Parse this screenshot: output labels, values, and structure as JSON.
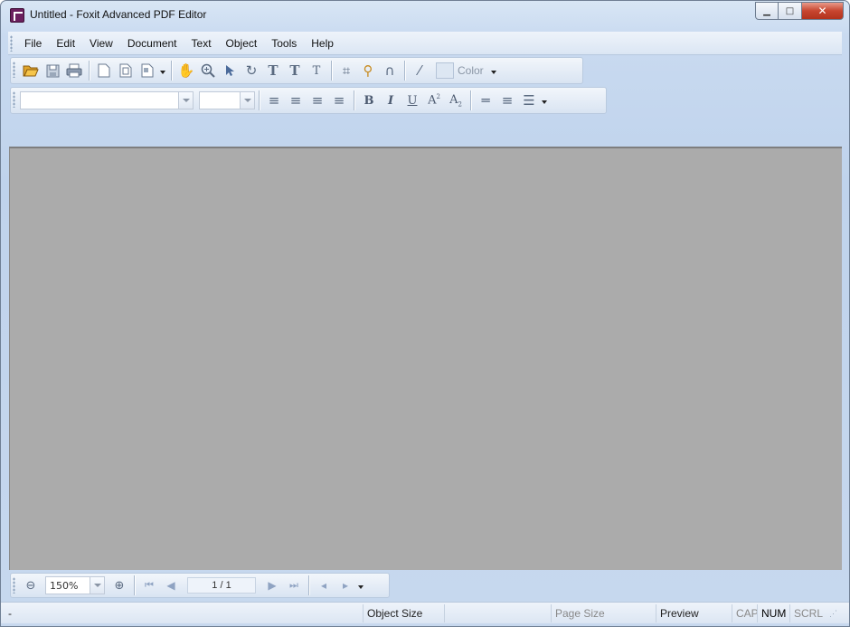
{
  "window": {
    "title": "Untitled - Foxit Advanced PDF Editor"
  },
  "menu": [
    "File",
    "Edit",
    "View",
    "Document",
    "Text",
    "Object",
    "Tools",
    "Help"
  ],
  "toolbar1": {
    "color_label": "Color"
  },
  "toolbar2": {
    "font_value": "",
    "size_value": ""
  },
  "navbar": {
    "zoom": "150%",
    "page": "1 / 1"
  },
  "statusbar": {
    "left": "-",
    "object_size": "Object Size",
    "page_size": "Page Size",
    "preview": "Preview",
    "cap": "CAP",
    "num": "NUM",
    "scrl": "SCRL"
  }
}
